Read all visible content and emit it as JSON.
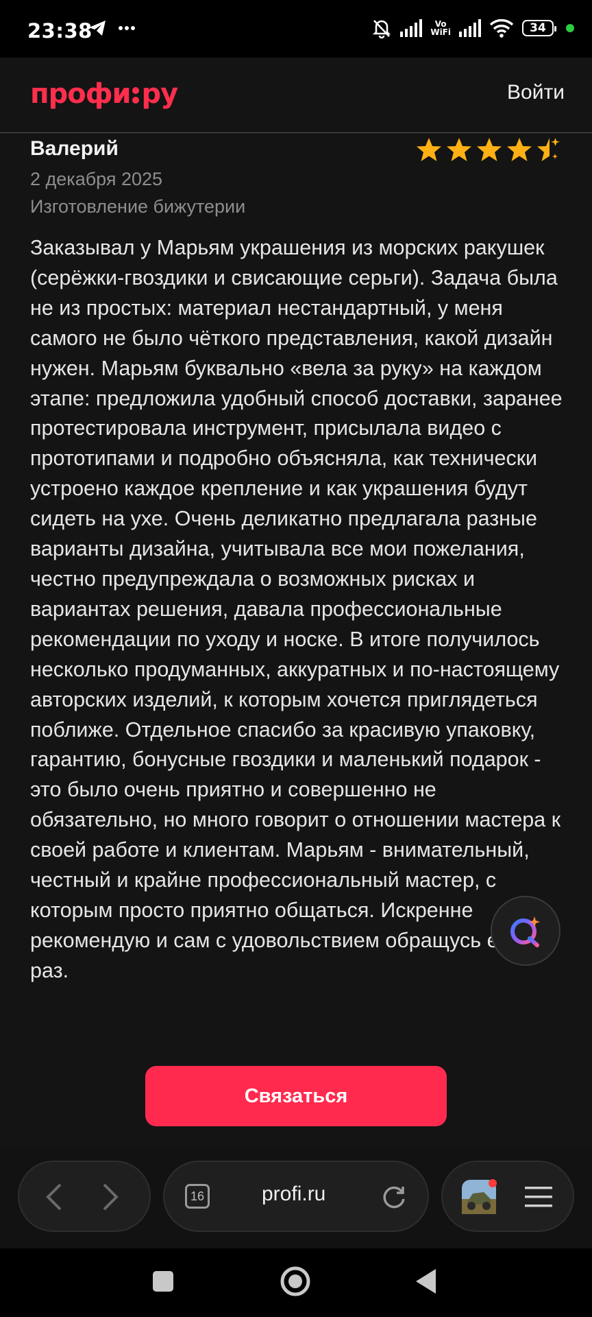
{
  "status_bar": {
    "time": "23:38",
    "network_label_top": "Vo",
    "network_label_bottom": "WiFi",
    "battery": "34",
    "icons": [
      "telegram-icon",
      "more-dots-icon",
      "mute-bell-icon",
      "signal-icon",
      "wifi-icon",
      "battery-icon"
    ]
  },
  "header": {
    "logo_left": "профи",
    "logo_right": "ру",
    "login_label": "Войти"
  },
  "review": {
    "author": "Валерий",
    "rating": 4.5,
    "rating_max": 5,
    "date": "2 декабря 2025",
    "service": "Изготовление бижутерии",
    "text": "Заказывал у Марьям украшения из морских ракушек (серёжки-гвоздики и свисающие серьги). Задача была не из простых: материал нестандартный, у меня самого не было чёткого представления, какой дизайн нужен. Марьям буквально «вела за руку» на каждом этапе: предложила удобный способ доставки, заранее протестировала инструмент, присылала видео с прототипами и подробно объясняла, как технически устроено каждое крепление и как украшения будут сидеть на ухе. Очень деликатно предлагала разные варианты дизайна, учитывала все мои пожелания, честно предупреждала о возможных рисках и вариантах решения, давала профессиональные рекомендации по уходу и носке. В итоге получилось несколько продуманных, аккуратных и по-настоящему авторских изделий, к которым хочется приглядеться поближе. Отдельное спасибо за красивую упаковку, гарантию, бонусные гвоздики и маленький подарок - это было очень приятно и совершенно не обязательно, но много говорит о отношении мастера к своей работе и клиентам. Марьям - внимательный, честный и крайне профессиональный мастер, с которым просто приятно общаться. Искренне рекомендую и сам с удовольствием обращусь ещё раз."
  },
  "contact_button": {
    "label": "Связаться"
  },
  "browser": {
    "tab_count": "16",
    "url": "profi.ru"
  },
  "colors": {
    "brand": "#ff2e4d",
    "star": "#ffb015",
    "background": "#141414"
  }
}
